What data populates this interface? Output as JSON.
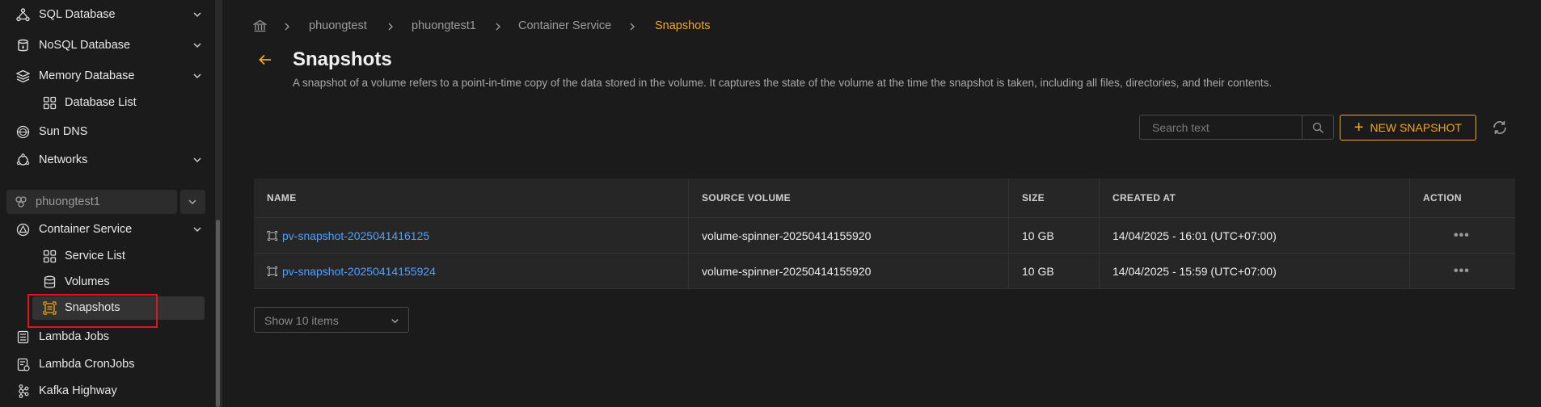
{
  "sidebar": {
    "items": [
      {
        "label": "SQL Database",
        "icon": "sql-database-icon",
        "has_chevron": true
      },
      {
        "label": "NoSQL Database",
        "icon": "nosql-database-icon",
        "has_chevron": true
      },
      {
        "label": "Memory Database",
        "icon": "memory-database-icon",
        "has_chevron": true
      },
      {
        "label": "Database List",
        "icon": "grid-icon",
        "sub": true
      },
      {
        "label": "Sun DNS",
        "icon": "dns-icon"
      },
      {
        "label": "Networks",
        "icon": "networks-icon",
        "has_chevron": true
      }
    ],
    "project": {
      "label": "phuongtest1",
      "icon": "project-icon"
    },
    "container_items": [
      {
        "label": "Container Service",
        "icon": "container-service-icon",
        "has_chevron": true
      },
      {
        "label": "Service List",
        "icon": "grid-icon",
        "sub": true
      },
      {
        "label": "Volumes",
        "icon": "volumes-icon",
        "sub": true
      },
      {
        "label": "Snapshots",
        "icon": "snapshots-icon",
        "sub": true,
        "active": true
      },
      {
        "label": "Lambda Jobs",
        "icon": "lambda-jobs-icon"
      },
      {
        "label": "Lambda CronJobs",
        "icon": "lambda-cronjobs-icon"
      },
      {
        "label": "Kafka Highway",
        "icon": "kafka-icon"
      }
    ]
  },
  "breadcrumb": {
    "items": [
      "phuongtest",
      "phuongtest1",
      "Container Service",
      "Snapshots"
    ]
  },
  "header": {
    "title": "Snapshots",
    "description": "A snapshot of a volume refers to a point-in-time copy of the data stored in the volume. It captures the state of the volume at the time the snapshot is taken, including all files, directories, and their contents."
  },
  "toolbar": {
    "search_placeholder": "Search text",
    "new_label": "NEW SNAPSHOT"
  },
  "table": {
    "columns": [
      "NAME",
      "SOURCE VOLUME",
      "SIZE",
      "CREATED AT",
      "ACTION"
    ],
    "rows": [
      {
        "name": "pv-snapshot-2025041416125",
        "source": "volume-spinner-20250414155920",
        "size": "10 GB",
        "created": "14/04/2025 - 16:01 (UTC+07:00)",
        "action": "•••"
      },
      {
        "name": "pv-snapshot-20250414155924",
        "source": "volume-spinner-20250414155920",
        "size": "10 GB",
        "created": "14/04/2025 - 15:59 (UTC+07:00)",
        "action": "•••"
      }
    ]
  },
  "pagination": {
    "page_size_label": "Show 10 items"
  },
  "colors": {
    "accent": "#f5a623",
    "link": "#4ea1ff",
    "highlight": "#e0161c"
  }
}
